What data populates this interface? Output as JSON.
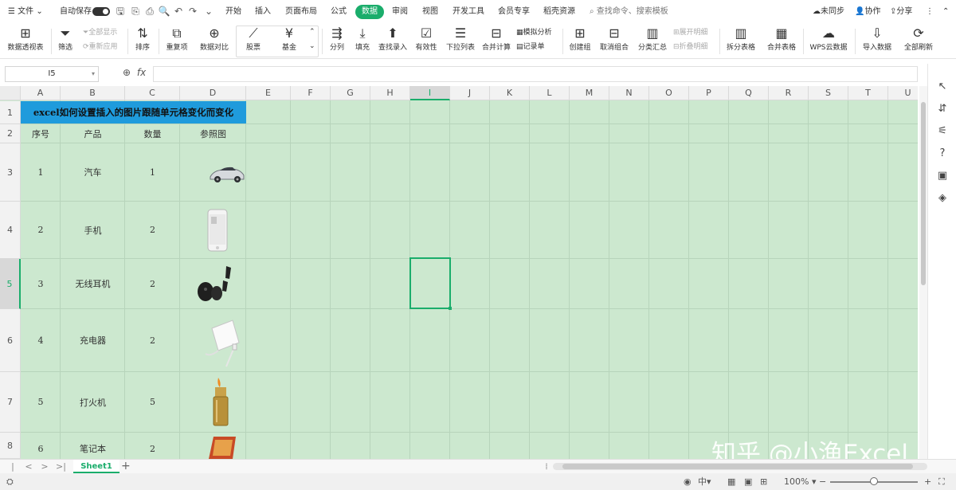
{
  "menubar": {
    "hamburger_icon": "hamburger-icon",
    "file": "文件",
    "autosave": "自动保存",
    "tabs": [
      "开始",
      "插入",
      "页面布局",
      "公式",
      "数据",
      "审阅",
      "视图",
      "开发工具",
      "会员专享",
      "稻壳资源"
    ],
    "active_tab": "数据",
    "search": "查找命令、搜索模板",
    "sync": "未同步",
    "collab": "协作",
    "share": "分享",
    "more": "⋮"
  },
  "ribbon": {
    "items": [
      {
        "label": "数据透视表",
        "icon": "pivot-table-icon"
      },
      {
        "label": "筛选",
        "icon": "filter-icon"
      },
      {
        "label": "全部显示",
        "icon": "show-all-icon"
      },
      {
        "label": "重新应用",
        "icon": "reapply-icon"
      },
      {
        "label": "排序",
        "icon": "sort-icon"
      },
      {
        "label": "重复项",
        "icon": "duplicates-icon"
      },
      {
        "label": "数据对比",
        "icon": "compare-icon"
      },
      {
        "label": "股票",
        "icon": "stock-icon"
      },
      {
        "label": "基金",
        "icon": "fund-icon"
      },
      {
        "label": "分列",
        "icon": "split-column-icon"
      },
      {
        "label": "填充",
        "icon": "fill-icon"
      },
      {
        "label": "查找录入",
        "icon": "lookup-icon"
      },
      {
        "label": "有效性",
        "icon": "validation-icon"
      },
      {
        "label": "下拉列表",
        "icon": "dropdown-list-icon"
      },
      {
        "label": "合并计算",
        "icon": "consolidate-icon"
      },
      {
        "label": "模拟分析",
        "icon": "what-if-icon"
      },
      {
        "label": "记录单",
        "icon": "record-form-icon"
      },
      {
        "label": "创建组",
        "icon": "group-icon"
      },
      {
        "label": "取消组合",
        "icon": "ungroup-icon"
      },
      {
        "label": "分类汇总",
        "icon": "subtotal-icon"
      },
      {
        "label": "展开明细",
        "icon": "expand-icon"
      },
      {
        "label": "折叠明细",
        "icon": "collapse-icon"
      },
      {
        "label": "拆分表格",
        "icon": "split-table-icon"
      },
      {
        "label": "合并表格",
        "icon": "merge-table-icon"
      },
      {
        "label": "WPS云数据",
        "icon": "cloud-data-icon"
      },
      {
        "label": "导入数据",
        "icon": "import-icon"
      },
      {
        "label": "全部刷新",
        "icon": "refresh-icon"
      }
    ]
  },
  "formula_bar": {
    "name_box": "I5",
    "fx": "fx",
    "value": ""
  },
  "sheet": {
    "columns": [
      "A",
      "B",
      "C",
      "D",
      "E",
      "F",
      "G",
      "H",
      "I",
      "J",
      "K",
      "L",
      "M",
      "N",
      "O",
      "P",
      "Q",
      "R",
      "S",
      "T",
      "U"
    ],
    "rows": [
      "1",
      "2",
      "3",
      "4",
      "5",
      "6",
      "7",
      "8"
    ],
    "selected_column": "I",
    "selected_row": "5",
    "title": "excel如何设置插入的图片跟随单元格变化而变化",
    "headers": [
      "序号",
      "产品",
      "数量",
      "参照图"
    ],
    "data": [
      {
        "no": "1",
        "product": "汽车",
        "qty": "1",
        "pic": "car-image"
      },
      {
        "no": "2",
        "product": "手机",
        "qty": "2",
        "pic": "phone-image"
      },
      {
        "no": "3",
        "product": "无线耳机",
        "qty": "2",
        "pic": "earbuds-image"
      },
      {
        "no": "4",
        "product": "充电器",
        "qty": "2",
        "pic": "charger-image"
      },
      {
        "no": "5",
        "product": "打火机",
        "qty": "5",
        "pic": "lighter-image"
      },
      {
        "no": "6",
        "product": "笔记本",
        "qty": "2",
        "pic": "laptop-image"
      }
    ],
    "fill_color": "#cce8cf",
    "title_color": "#1f9bdc",
    "accent": "#1aad6b"
  },
  "watermark": "知乎 @小渔Excel",
  "tabs": {
    "sheet": "Sheet1",
    "add": "+"
  },
  "status": {
    "zoom": "100%",
    "minus": "−",
    "plus": "+",
    "lang": "中",
    "icons": [
      "eye-protect-icon",
      "normal-view-icon",
      "page-layout-icon",
      "page-break-icon",
      "fullscreen-icon"
    ]
  }
}
